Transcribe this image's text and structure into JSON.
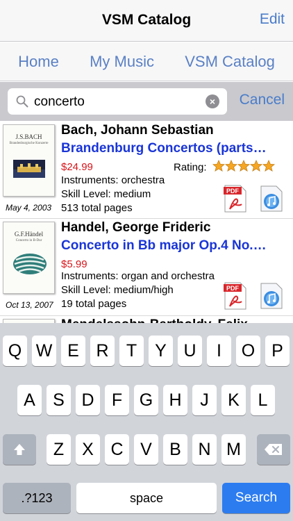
{
  "navbar": {
    "title": "VSM Catalog",
    "edit_label": "Edit"
  },
  "tabs": [
    {
      "label": "Home"
    },
    {
      "label": "My Music"
    },
    {
      "label": "VSM Catalog"
    }
  ],
  "search": {
    "value": "concerto",
    "cancel_label": "Cancel"
  },
  "results": [
    {
      "composer": "Bach, Johann Sebastian",
      "title": "Brandenburg Concertos (parts…",
      "price": "$24.99",
      "instruments": "Instruments: orchestra",
      "skill": "Skill Level: medium",
      "pages": "513 total pages",
      "date": "May 4, 2003",
      "rating_label": "Rating:",
      "rating": 5,
      "cover_composer": "J.S.BACH",
      "cover_sub": "Brandenburgische Konzerte"
    },
    {
      "composer": "Handel, George Frideric",
      "title": "Concerto in Bb major Op.4 No.…",
      "price": "$5.99",
      "instruments": "Instruments: organ and orchestra",
      "skill": "Skill Level: medium/high",
      "pages": "19 total pages",
      "date": "Oct 13, 2007",
      "cover_composer": "G.F.Händel",
      "cover_sub": "Concerto in B-Dur"
    },
    {
      "composer": "Mendelssohn-Bartholdy, Felix"
    }
  ],
  "keyboard": {
    "row1": [
      "Q",
      "W",
      "E",
      "R",
      "T",
      "Y",
      "U",
      "I",
      "O",
      "P"
    ],
    "row2": [
      "A",
      "S",
      "D",
      "F",
      "G",
      "H",
      "J",
      "K",
      "L"
    ],
    "row3": [
      "Z",
      "X",
      "C",
      "V",
      "B",
      "N",
      "M"
    ],
    "numbers_label": ".?123",
    "space_label": "space",
    "search_label": "Search"
  },
  "colors": {
    "accent": "#4a7cc9",
    "link": "#1a35d6",
    "price": "#d6151a",
    "search_key": "#2c7cf0"
  }
}
